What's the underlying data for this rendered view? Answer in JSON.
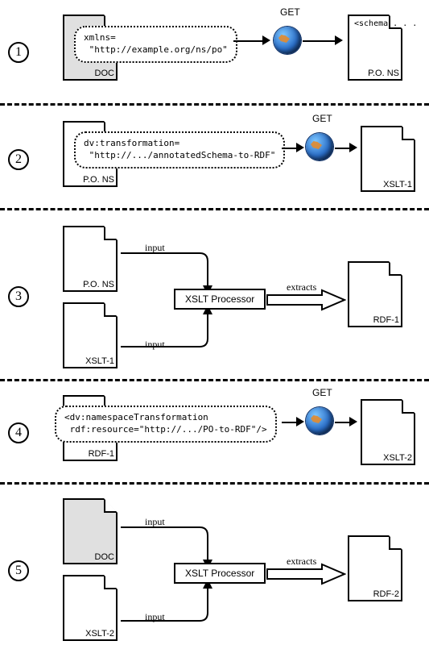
{
  "separatorDash": "- - - - - - - - - - - - - - - - - - - - -",
  "steps": [
    {
      "num": "1",
      "sourceDoc": {
        "label": "DOC",
        "fill": "gray"
      },
      "bubble": "xmlns=\n \"http://example.org/ns/po\"",
      "action": "GET",
      "targetDoc": {
        "label": "P.O. NS",
        "fill": "white",
        "snippet": "<schema\n. . ."
      }
    },
    {
      "num": "2",
      "sourceDoc": {
        "label": "P.O. NS",
        "fill": "white"
      },
      "bubble": "dv:transformation=\n \"http://.../annotatedSchema-to-RDF\"",
      "action": "GET",
      "targetDoc": {
        "label": "XSLT-1",
        "fill": "white"
      }
    },
    {
      "num": "3",
      "inputA": {
        "label": "P.O. NS",
        "fill": "white"
      },
      "inputB": {
        "label": "XSLT-1",
        "fill": "white"
      },
      "inputLabel": "input",
      "processor": "XSLT Processor",
      "outputArrow": "extracts",
      "output": {
        "label": "RDF-1",
        "fill": "white"
      }
    },
    {
      "num": "4",
      "sourceDoc": {
        "label": "RDF-1",
        "fill": "white"
      },
      "bubble": "<dv:namespaceTransformation\n rdf:resource=\"http://.../PO-to-RDF\"/>",
      "action": "GET",
      "targetDoc": {
        "label": "XSLT-2",
        "fill": "white"
      }
    },
    {
      "num": "5",
      "inputA": {
        "label": "DOC",
        "fill": "gray"
      },
      "inputB": {
        "label": "XSLT-2",
        "fill": "white"
      },
      "inputLabel": "input",
      "processor": "XSLT Processor",
      "outputArrow": "extracts",
      "output": {
        "label": "RDF-2",
        "fill": "white"
      }
    }
  ]
}
